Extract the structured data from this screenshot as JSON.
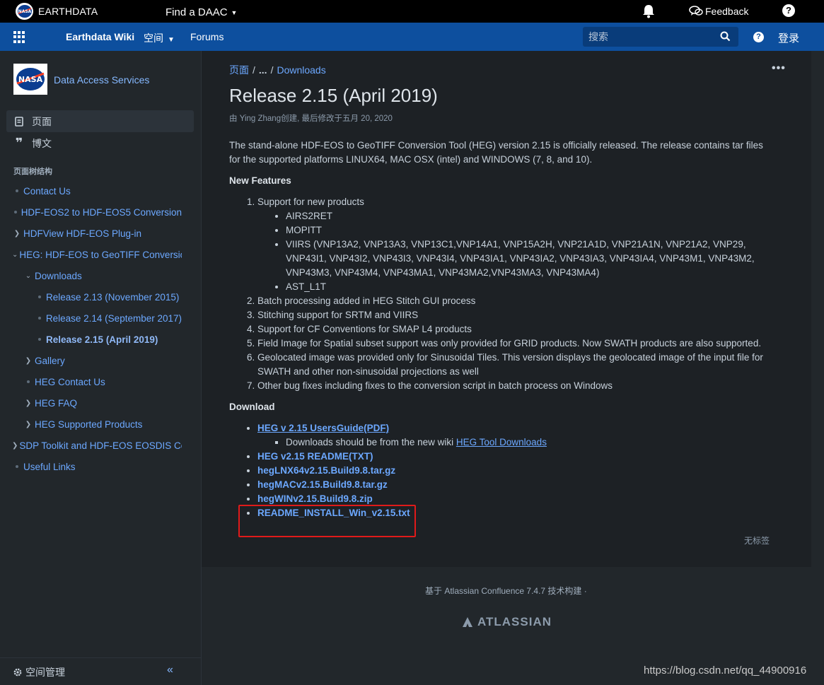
{
  "topbar": {
    "brand": "EARTHDATA",
    "daac": "Find a DAAC",
    "feedback": "Feedback",
    "help": "?"
  },
  "navbar": {
    "wiki": "Earthdata Wiki",
    "space": "空间",
    "forums": "Forums",
    "search_placeholder": "搜索",
    "help": "?",
    "login": "登录"
  },
  "sidebar": {
    "space_name": "Data Access Services",
    "nav": [
      {
        "label": "页面"
      },
      {
        "label": "博文"
      }
    ],
    "tree_title": "页面树结构",
    "tree": [
      {
        "label": "Contact Us"
      },
      {
        "label": "HDF-EOS2 to HDF-EOS5 Conversion"
      },
      {
        "label": "HDFView HDF-EOS Plug-in"
      },
      {
        "label": "HEG: HDF-EOS to GeoTIFF Conversion"
      },
      {
        "label": "Downloads"
      },
      {
        "label": "Release 2.13 (November 2015)"
      },
      {
        "label": "Release 2.14 (September 2017)"
      },
      {
        "label": "Release 2.15 (April 2019)"
      },
      {
        "label": "Gallery"
      },
      {
        "label": "HEG Contact Us"
      },
      {
        "label": "HEG FAQ"
      },
      {
        "label": "HEG Supported Products"
      },
      {
        "label": "SDP Toolkit and HDF-EOS EOSDIS Core"
      },
      {
        "label": "Useful Links"
      }
    ],
    "manage": "空间管理",
    "collapse": "«"
  },
  "main": {
    "crumb_root": "页面",
    "crumb_ellipsis": "...",
    "crumb_current": "Downloads",
    "more": "•••",
    "title": "Release 2.15 (April 2019)",
    "meta": "由 Ying Zhang创建, 最后修改于五月 20, 2020",
    "intro": "The stand-alone HDF-EOS to GeoTIFF Conversion Tool (HEG) version 2.15 is officially released. The release contains tar files for the supported platforms LINUX64, MAC OSX (intel) and WINDOWS (7, 8, and 10).",
    "features_heading": "New Features",
    "features": {
      "f1": "Support for new products",
      "f1_sub": [
        "AIRS2RET",
        "MOPITT",
        "VIIRS (VNP13A2, VNP13A3, VNP13C1,VNP14A1, VNP15A2H, VNP21A1D, VNP21A1N, VNP21A2, VNP29, VNP43I1, VNP43I2, VNP43I3, VNP43I4, VNP43IA1, VNP43IA2, VNP43IA3, VNP43IA4, VNP43M1, VNP43M2, VNP43M3, VNP43M4, VNP43MA1, VNP43MA2,VNP43MA3, VNP43MA4)",
        "AST_L1T"
      ],
      "f2": "Batch processing added in HEG Stitch GUI process",
      "f3": "Stitching support for SRTM and VIIRS",
      "f4": "Support for CF Conventions for SMAP L4 products",
      "f5": "Field Image for Spatial subset support was only provided for GRID products. Now SWATH products are also supported.",
      "f6": "Geolocated image was provided only for Sinusoidal Tiles. This version displays the geolocated image of the input file for SWATH and other non-sinusoidal projections as well",
      "f7": "Other bug fixes including fixes to the conversion script in batch process on Windows"
    },
    "download_heading": "Download",
    "downloads": {
      "guide": "HEG v 2.15 UsersGuide(PDF)",
      "note_prefix": "Downloads should be from the new wiki ",
      "note_link": "HEG Tool Downloads",
      "readme": "HEG v2.15 README(TXT)",
      "lnx": "hegLNX64v2.15.Build9.8.tar.gz",
      "mac": "hegMACv2.15.Build9.8.tar.gz",
      "win": "hegWINv2.15.Build9.8.zip",
      "readme_win": "README_INSTALL_Win_v2.15.txt"
    },
    "no_labels": "无标签"
  },
  "footer": {
    "powered": "基于 Atlassian Confluence 7.4.7 技术构建 ·",
    "atlassian": "ATLASSIAN"
  },
  "watermark": "https://blog.csdn.net/qq_44900916",
  "colors": {
    "topbar": "#000000",
    "navbar": "#0d4f9e",
    "sidebar": "#22272b",
    "content": "#1d2125",
    "link": "#6ca8ff",
    "highlight_box": "#e01a1a"
  }
}
